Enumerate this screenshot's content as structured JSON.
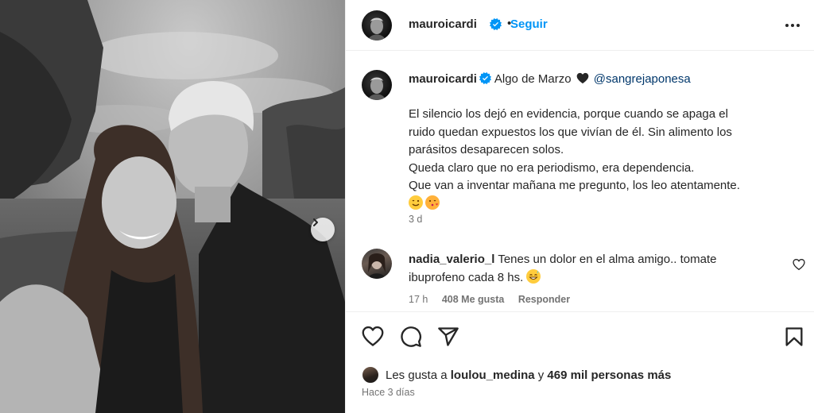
{
  "header": {
    "username": "mauroicardi",
    "separator": "•",
    "follow_label": "Seguir",
    "more_icon": "more-horizontal-icon"
  },
  "caption": {
    "username": "mauroicardi",
    "title": "Algo de Marzo",
    "mention": "@sangrejaponesa",
    "lines": [
      "El silencio los dejó en evidencia, porque cuando se apaga el",
      "ruido quedan expuestos los que vivían de él. Sin alimento los",
      "parásitos desaparecen solos.",
      "Queda claro que no era periodismo, era dependencia.",
      "Que van a inventar mañana me pregunto, los leo atentamente."
    ],
    "emojis": [
      "winking-face-emoji",
      "face-blowing-kiss-emoji"
    ],
    "time": "3 d"
  },
  "comment": {
    "username": "nadia_valerio_l",
    "text": "Tenes un dolor en el alma amigo.. tomate ibuprofeno cada 8 hs.",
    "emoji": "grinning-sweat-emoji",
    "time": "17 h",
    "likes": "408 Me gusta",
    "reply_label": "Responder"
  },
  "actions": {
    "icons": [
      "heart-icon",
      "comment-icon",
      "share-icon",
      "bookmark-icon"
    ]
  },
  "likes": {
    "prefix": "Les gusta a",
    "user": "loulou_medina",
    "connector": "y",
    "others": "469 mil personas más"
  },
  "post_date": "Hace 3 días",
  "colors": {
    "accent": "#0095f6",
    "text": "#262626",
    "muted": "#737373",
    "verified": "#0095f6",
    "mention": "#00376b",
    "border": "#efefef"
  }
}
